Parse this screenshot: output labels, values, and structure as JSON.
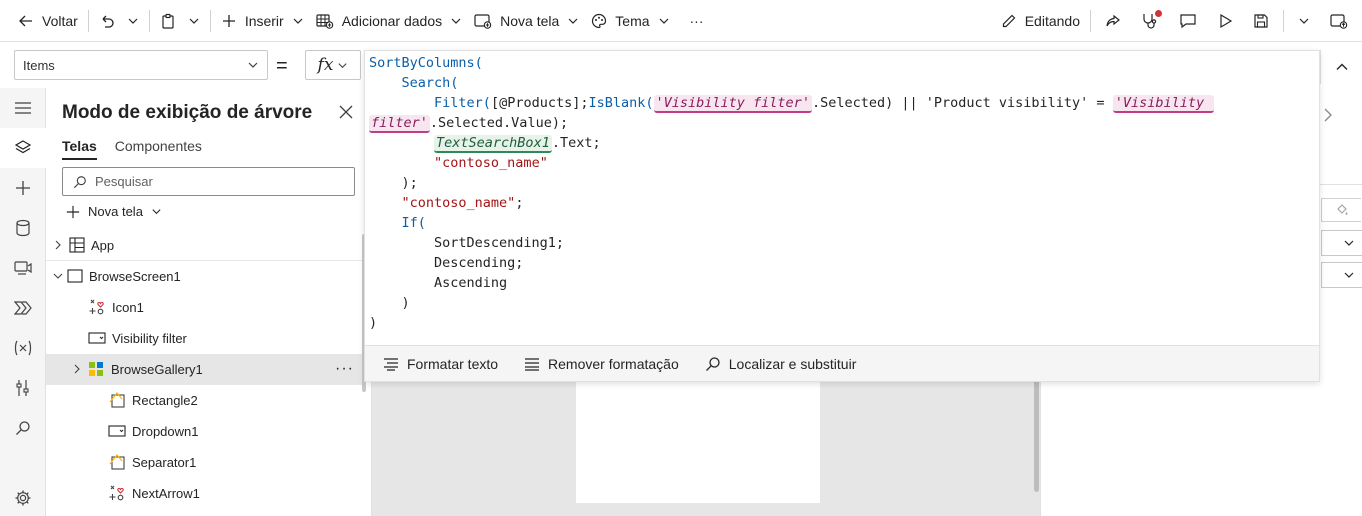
{
  "toolbar": {
    "back_label": "Voltar",
    "insert_label": "Inserir",
    "add_data_label": "Adicionar dados",
    "new_screen_label": "Nova tela",
    "theme_label": "Tema",
    "more_label": "···",
    "editing_label": "Editando"
  },
  "formula_bar": {
    "property": "Items",
    "equals": "=",
    "fx": "fx"
  },
  "tree": {
    "title": "Modo de exibição de árvore",
    "tabs": [
      "Telas",
      "Componentes"
    ],
    "search_placeholder": "Pesquisar",
    "new_screen_label": "Nova tela",
    "nodes": [
      {
        "label": "App"
      },
      {
        "label": "BrowseScreen1"
      },
      {
        "label": "Icon1"
      },
      {
        "label": "Visibility filter"
      },
      {
        "label": "BrowseGallery1"
      },
      {
        "label": "Rectangle2"
      },
      {
        "label": "Dropdown1"
      },
      {
        "label": "Separator1"
      },
      {
        "label": "NextArrow1"
      }
    ]
  },
  "editor": {
    "lines": [
      "SortByColumns(",
      "    Search(",
      "        Filter([@Products];IsBlank('Visibility filter'.Selected) || 'Product visibility' = 'Visibility",
      "filter'.Selected.Value);",
      "        TextSearchBox1.Text;",
      "        \"contoso_name\"",
      "    );",
      "    \"contoso_name\";",
      "    If(",
      "        SortDescending1;",
      "        Descending;",
      "        Ascending",
      "    )",
      ")"
    ],
    "footer": {
      "format_label": "Formatar texto",
      "remove_format_label": "Remover formatação",
      "find_replace_label": "Localizar e substituir"
    }
  },
  "colors": {
    "accent_pill": "#c23b8a",
    "control_pill": "#2e8b57",
    "keyword": "#0b5ea8",
    "string": "#a31515",
    "notification_dot": "#d13438"
  }
}
